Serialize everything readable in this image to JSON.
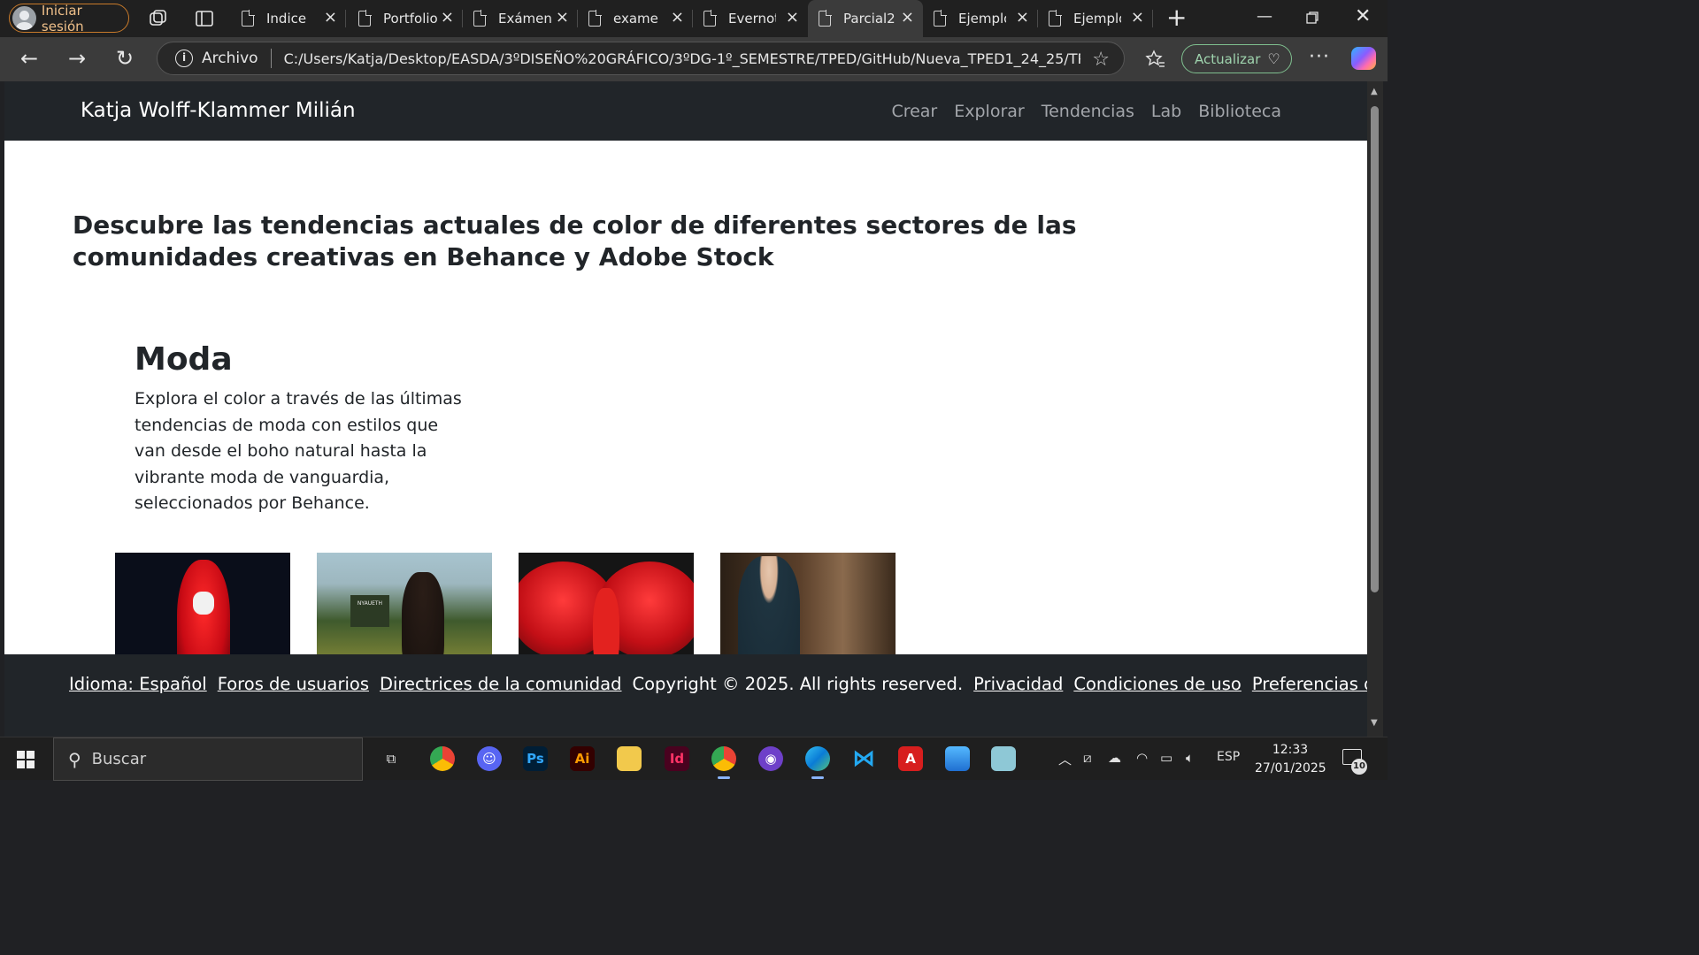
{
  "browser": {
    "profile_label": "Iniciar sesión",
    "tabs": [
      {
        "label": "Indice"
      },
      {
        "label": "Portfolio"
      },
      {
        "label": "Exámen"
      },
      {
        "label": "examen"
      },
      {
        "label": "Evernote"
      },
      {
        "label": "Parcial2"
      },
      {
        "label": "Ejemplo"
      },
      {
        "label": "Ejemplo"
      }
    ],
    "active_tab_index": 5,
    "address": {
      "scheme_label": "Archivo",
      "url": "C:/Users/Katja/Desktop/EASDA/3ºDISEÑO%20GRÁFICO/3ºDG-1º_SEMESTRE/TPED/GitHub/Nueva_TPED1_24_25/TPE..."
    },
    "update_label": "Actualizar",
    "icons": [
      "back-icon",
      "forward-icon",
      "refresh-icon",
      "info-icon",
      "favorite-star-icon",
      "favorites-icon",
      "more-icon",
      "copilot-icon"
    ]
  },
  "site": {
    "brand": "Katja Wolff-Klammer Milián",
    "nav": [
      "Crear",
      "Explorar",
      "Tendencias",
      "Lab",
      "Biblioteca"
    ],
    "hero_title": "Descubre las tendencias actuales de color de diferentes sectores de las comunidades creativas en Behance y Adobe Stock",
    "section": {
      "title": "Moda",
      "description": "Explora el color a través de las últimas tendencias de moda con estilos que van desde el boho natural hasta la vibrante moda de vanguardia, seleccionados por Behance."
    },
    "gallery": [
      {
        "poster_text": ""
      },
      {
        "poster_text": "NYAUETH"
      },
      {
        "poster_text": ""
      },
      {
        "poster_text": ""
      }
    ],
    "footer": {
      "links_before": [
        "Idioma: Español",
        "Foros de usuarios",
        "Directrices de la comunidad"
      ],
      "copyright": "Copyright © 2025. All rights reserved.",
      "links_after": [
        "Privacidad",
        "Condiciones de uso",
        "Preferencias de cookies"
      ]
    },
    "colors": {
      "header_bg": "#212529",
      "nav_link": "#a3a6ab",
      "text": "#212529"
    }
  },
  "taskbar": {
    "search_placeholder": "Buscar",
    "apps": [
      "Chrome",
      "Discord",
      "Ps",
      "Ai",
      "Explorer",
      "Id",
      "Chrome Profile",
      "GitHub",
      "Edge",
      "VS Code",
      "Acrobat",
      "Photos",
      "Notes"
    ],
    "language": "ESP",
    "time": "12:33",
    "date": "27/01/2025",
    "notifications": "10"
  }
}
